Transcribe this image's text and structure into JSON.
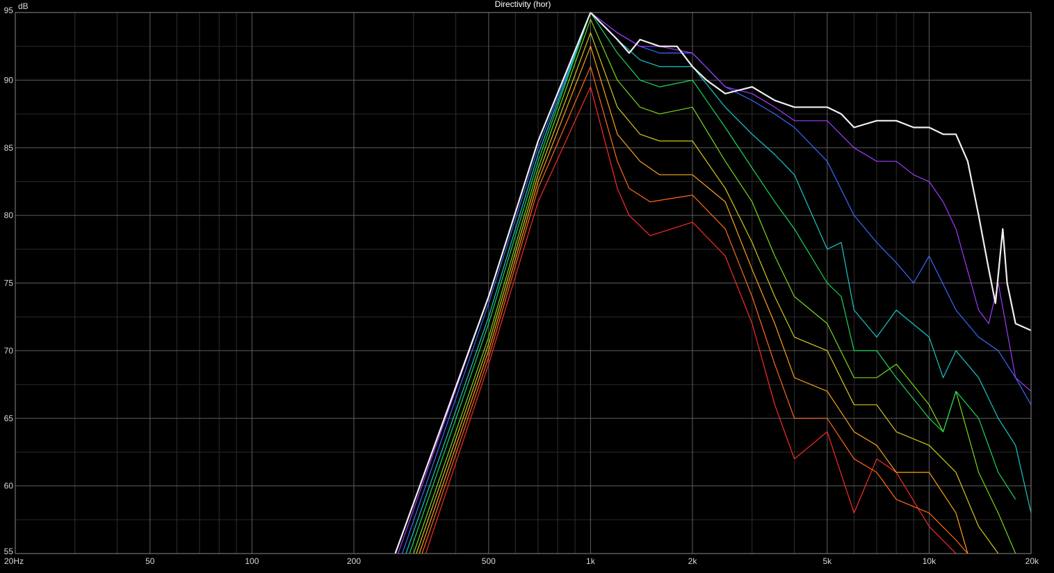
{
  "chart_data": {
    "type": "line",
    "title": "Directivity (hor)",
    "ylabel": "dB",
    "xlabel": "",
    "x_scale": "log",
    "xlim": [
      20,
      20000
    ],
    "ylim": [
      55,
      95
    ],
    "grid": true,
    "x_ticks": [
      {
        "value": 20,
        "label": "20Hz"
      },
      {
        "value": 50,
        "label": "50"
      },
      {
        "value": 100,
        "label": "100"
      },
      {
        "value": 200,
        "label": "200"
      },
      {
        "value": 500,
        "label": "500"
      },
      {
        "value": 1000,
        "label": "1k"
      },
      {
        "value": 2000,
        "label": "2k"
      },
      {
        "value": 5000,
        "label": "5k"
      },
      {
        "value": 10000,
        "label": "10k"
      },
      {
        "value": 20000,
        "label": "20k"
      }
    ],
    "y_ticks": [
      95,
      90,
      85,
      80,
      75,
      70,
      65,
      60,
      55
    ],
    "series": [
      {
        "color": "#ff2a2a",
        "points": [
          [
            326,
            55
          ],
          [
            500,
            69
          ],
          [
            700,
            81
          ],
          [
            1000,
            89.5
          ],
          [
            1200,
            82
          ],
          [
            1300,
            80
          ],
          [
            1500,
            78.5
          ],
          [
            2000,
            79.5
          ],
          [
            2500,
            77
          ],
          [
            3000,
            72
          ],
          [
            3500,
            66
          ],
          [
            4000,
            62
          ],
          [
            5000,
            64
          ],
          [
            6000,
            58
          ],
          [
            7000,
            62
          ],
          [
            8000,
            61
          ],
          [
            10000,
            57
          ],
          [
            12000,
            55
          ]
        ]
      },
      {
        "color": "#ff6a1a",
        "points": [
          [
            318,
            55
          ],
          [
            500,
            69.5
          ],
          [
            700,
            82
          ],
          [
            1000,
            91
          ],
          [
            1200,
            84
          ],
          [
            1300,
            82
          ],
          [
            1500,
            81
          ],
          [
            2000,
            81.5
          ],
          [
            2500,
            79
          ],
          [
            3000,
            74
          ],
          [
            3500,
            69
          ],
          [
            4000,
            65
          ],
          [
            5000,
            65
          ],
          [
            6000,
            62
          ],
          [
            7000,
            61
          ],
          [
            8000,
            59
          ],
          [
            10000,
            58
          ],
          [
            12000,
            56
          ],
          [
            13000,
            55
          ]
        ]
      },
      {
        "color": "#ffa21a",
        "points": [
          [
            312,
            55
          ],
          [
            500,
            70
          ],
          [
            700,
            82.5
          ],
          [
            1000,
            92.5
          ],
          [
            1200,
            86
          ],
          [
            1400,
            84
          ],
          [
            1600,
            83
          ],
          [
            2000,
            83
          ],
          [
            2500,
            81
          ],
          [
            3000,
            76
          ],
          [
            3500,
            72
          ],
          [
            4000,
            68
          ],
          [
            5000,
            67
          ],
          [
            6000,
            64
          ],
          [
            7000,
            63
          ],
          [
            8000,
            61
          ],
          [
            10000,
            61
          ],
          [
            12000,
            58
          ],
          [
            13000,
            55
          ]
        ]
      },
      {
        "color": "#d6c81a",
        "points": [
          [
            306,
            55
          ],
          [
            500,
            70.5
          ],
          [
            700,
            83
          ],
          [
            1000,
            93.5
          ],
          [
            1200,
            88
          ],
          [
            1400,
            86
          ],
          [
            1600,
            85.5
          ],
          [
            2000,
            85.5
          ],
          [
            2500,
            82
          ],
          [
            3000,
            78
          ],
          [
            3500,
            74
          ],
          [
            4000,
            71
          ],
          [
            5000,
            70
          ],
          [
            6000,
            66
          ],
          [
            7000,
            66
          ],
          [
            8000,
            64
          ],
          [
            10000,
            63
          ],
          [
            12000,
            61
          ],
          [
            14000,
            57
          ],
          [
            16000,
            55
          ]
        ]
      },
      {
        "color": "#7ad81a",
        "points": [
          [
            300,
            55
          ],
          [
            500,
            71
          ],
          [
            700,
            83.5
          ],
          [
            1000,
            94.5
          ],
          [
            1200,
            90
          ],
          [
            1400,
            88
          ],
          [
            1600,
            87.5
          ],
          [
            2000,
            88
          ],
          [
            2500,
            84
          ],
          [
            3000,
            81
          ],
          [
            3500,
            77
          ],
          [
            4000,
            74
          ],
          [
            5000,
            72
          ],
          [
            6000,
            68
          ],
          [
            7000,
            68
          ],
          [
            8000,
            69
          ],
          [
            10000,
            66
          ],
          [
            11000,
            64
          ],
          [
            12000,
            67
          ],
          [
            14000,
            61
          ],
          [
            16000,
            58
          ],
          [
            18000,
            55
          ]
        ]
      },
      {
        "color": "#1ad85a",
        "points": [
          [
            292,
            55
          ],
          [
            500,
            72
          ],
          [
            700,
            84
          ],
          [
            1000,
            95
          ],
          [
            1200,
            92
          ],
          [
            1400,
            90
          ],
          [
            1600,
            89.5
          ],
          [
            2000,
            90
          ],
          [
            2500,
            86.5
          ],
          [
            3000,
            83.5
          ],
          [
            3500,
            81
          ],
          [
            4000,
            79
          ],
          [
            5000,
            75
          ],
          [
            5500,
            74
          ],
          [
            6000,
            70
          ],
          [
            7000,
            70
          ],
          [
            8000,
            68
          ],
          [
            10000,
            65
          ],
          [
            11000,
            64
          ],
          [
            12000,
            67
          ],
          [
            14000,
            65
          ],
          [
            16000,
            61
          ],
          [
            18000,
            59
          ]
        ]
      },
      {
        "color": "#1ac8c8",
        "points": [
          [
            285,
            55
          ],
          [
            500,
            72.5
          ],
          [
            700,
            84.5
          ],
          [
            1000,
            95
          ],
          [
            1200,
            93
          ],
          [
            1400,
            91.5
          ],
          [
            1600,
            91
          ],
          [
            2000,
            91
          ],
          [
            2500,
            88
          ],
          [
            3000,
            86
          ],
          [
            3500,
            84.5
          ],
          [
            4000,
            83
          ],
          [
            5000,
            77.5
          ],
          [
            5500,
            78
          ],
          [
            6000,
            73
          ],
          [
            7000,
            71
          ],
          [
            8000,
            73
          ],
          [
            10000,
            71
          ],
          [
            11000,
            68
          ],
          [
            12000,
            70
          ],
          [
            14000,
            68
          ],
          [
            16000,
            65
          ],
          [
            18000,
            63
          ],
          [
            20000,
            58
          ]
        ]
      },
      {
        "color": "#3a6aff",
        "points": [
          [
            278,
            55
          ],
          [
            500,
            73.5
          ],
          [
            700,
            85
          ],
          [
            1000,
            95
          ],
          [
            1200,
            93.5
          ],
          [
            1400,
            92.5
          ],
          [
            1600,
            92
          ],
          [
            2000,
            92
          ],
          [
            2500,
            89.5
          ],
          [
            3000,
            88.5
          ],
          [
            3500,
            87.5
          ],
          [
            4000,
            86.5
          ],
          [
            5000,
            84
          ],
          [
            6000,
            80
          ],
          [
            7000,
            78
          ],
          [
            8000,
            76.5
          ],
          [
            9000,
            75
          ],
          [
            10000,
            77
          ],
          [
            12000,
            73
          ],
          [
            14000,
            71
          ],
          [
            16000,
            70
          ],
          [
            18000,
            68
          ],
          [
            20000,
            66
          ]
        ]
      },
      {
        "color": "#a23aff",
        "points": [
          [
            270,
            55
          ],
          [
            500,
            74
          ],
          [
            700,
            85.5
          ],
          [
            1000,
            95
          ],
          [
            1200,
            93.5
          ],
          [
            1400,
            92.5
          ],
          [
            1600,
            92.5
          ],
          [
            2000,
            92
          ],
          [
            2500,
            89.5
          ],
          [
            3000,
            89
          ],
          [
            3500,
            88
          ],
          [
            4000,
            87
          ],
          [
            5000,
            87
          ],
          [
            6000,
            85
          ],
          [
            7000,
            84
          ],
          [
            8000,
            84
          ],
          [
            9000,
            83
          ],
          [
            10000,
            82.5
          ],
          [
            11000,
            81
          ],
          [
            12000,
            79
          ],
          [
            14000,
            73
          ],
          [
            15000,
            72
          ],
          [
            16000,
            75
          ],
          [
            18000,
            68
          ],
          [
            20000,
            67
          ]
        ]
      },
      {
        "color": "#f0f0f0",
        "width": 2.2,
        "points": [
          [
            265,
            55
          ],
          [
            500,
            74
          ],
          [
            700,
            85.5
          ],
          [
            1000,
            95
          ],
          [
            1200,
            93
          ],
          [
            1300,
            92
          ],
          [
            1400,
            93
          ],
          [
            1600,
            92.5
          ],
          [
            1800,
            92.5
          ],
          [
            2000,
            91
          ],
          [
            2200,
            90
          ],
          [
            2500,
            89
          ],
          [
            3000,
            89.5
          ],
          [
            3500,
            88.5
          ],
          [
            4000,
            88
          ],
          [
            5000,
            88
          ],
          [
            5500,
            87.5
          ],
          [
            6000,
            86.5
          ],
          [
            7000,
            87
          ],
          [
            8000,
            87
          ],
          [
            9000,
            86.5
          ],
          [
            10000,
            86.5
          ],
          [
            11000,
            86
          ],
          [
            12000,
            86
          ],
          [
            13000,
            84
          ],
          [
            14000,
            80
          ],
          [
            15000,
            76
          ],
          [
            15700,
            73.5
          ],
          [
            16500,
            79
          ],
          [
            17000,
            75
          ],
          [
            18000,
            72
          ],
          [
            20000,
            71.5
          ]
        ]
      }
    ]
  }
}
